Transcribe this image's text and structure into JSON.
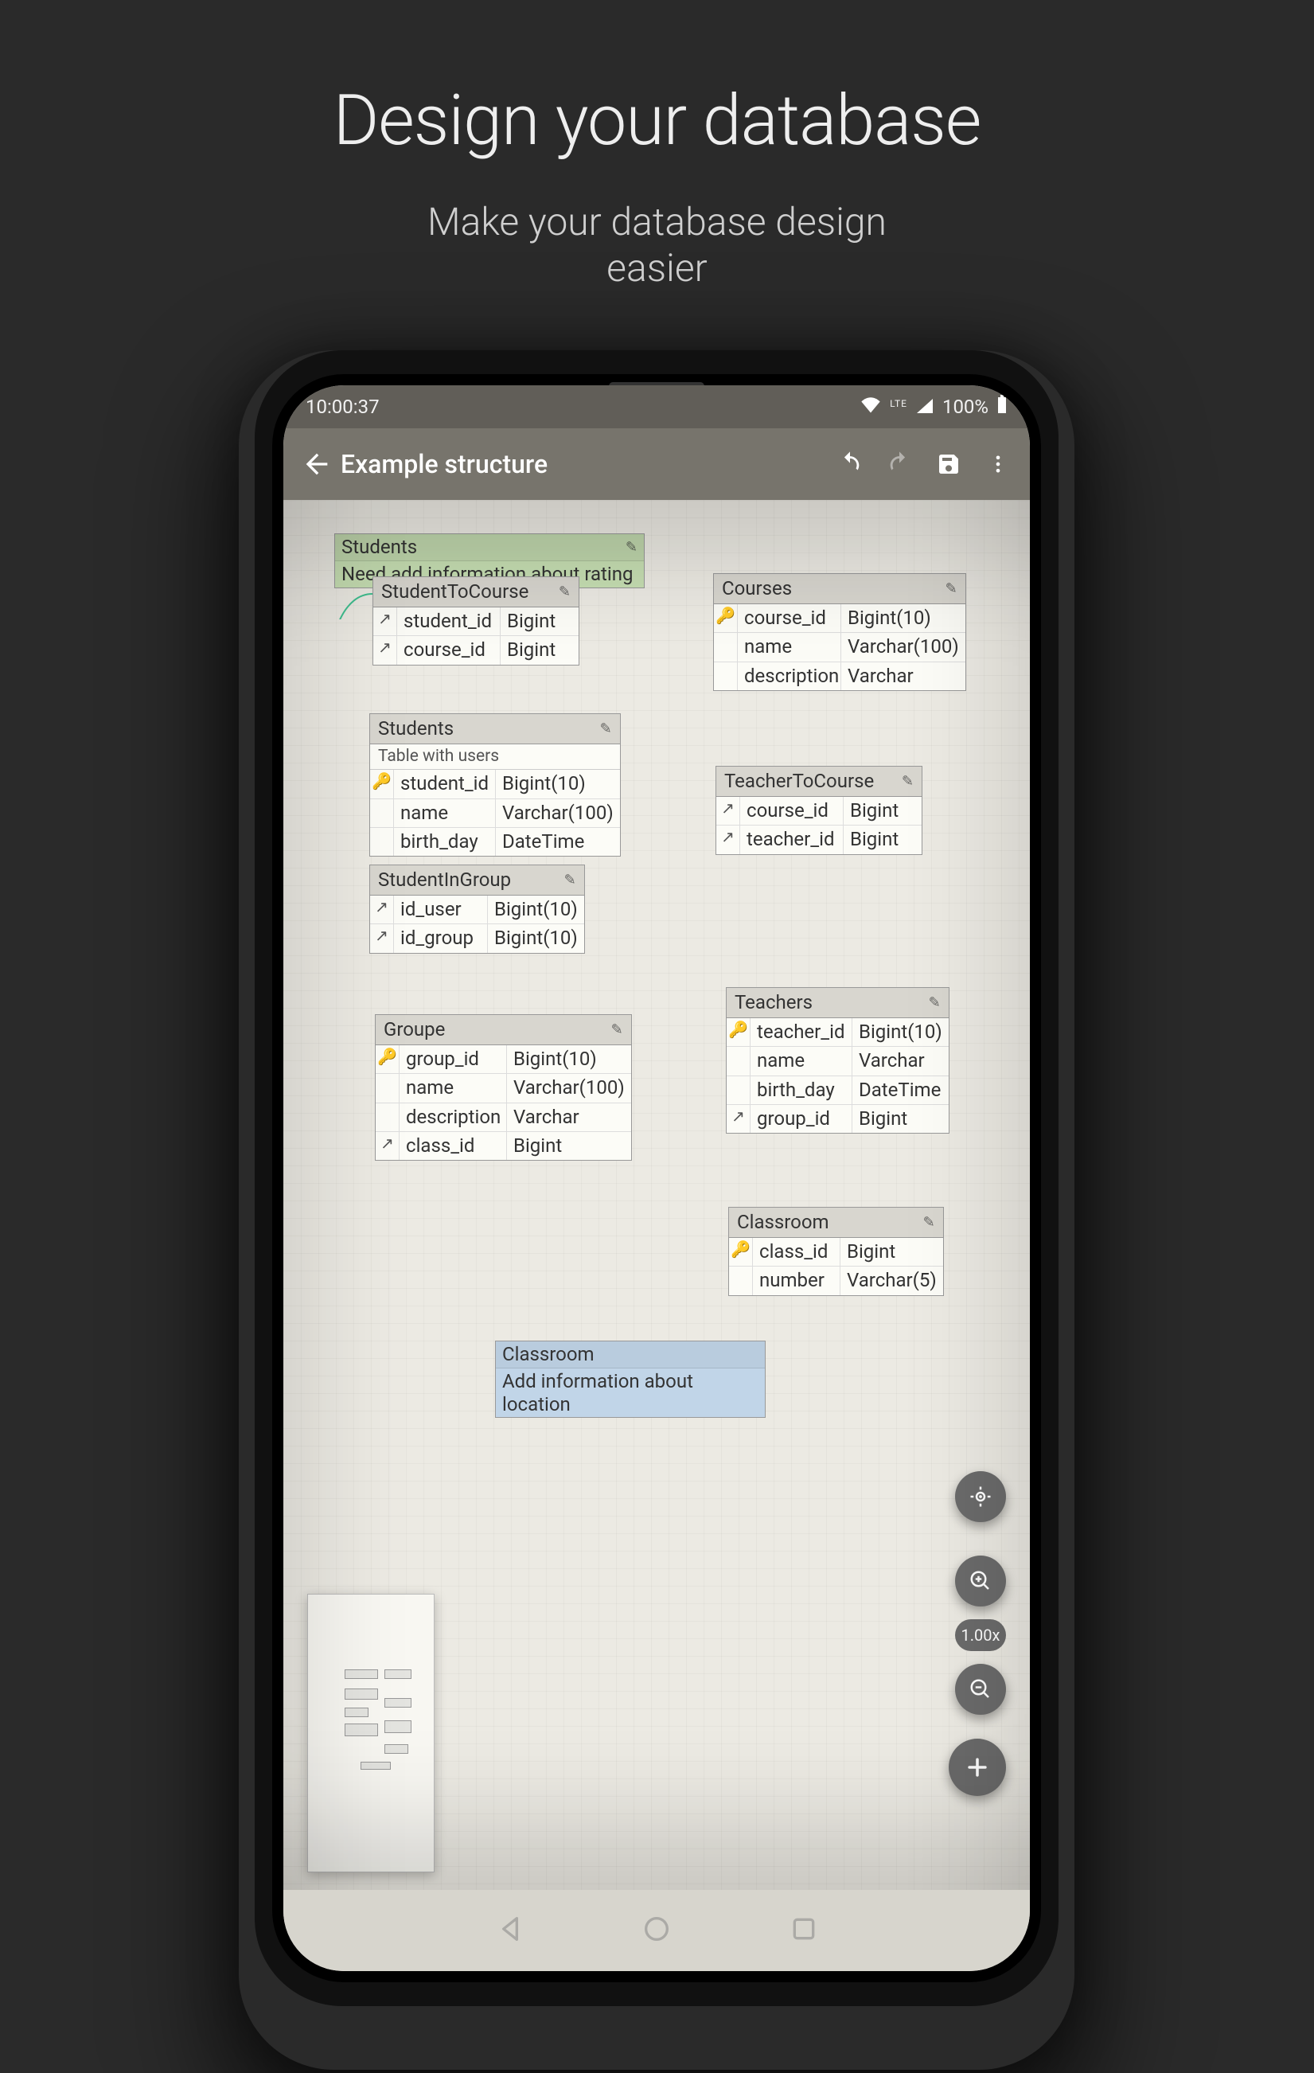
{
  "promo": {
    "title": "Design your database",
    "subtitle1": "Make your database design",
    "subtitle2": "easier"
  },
  "statusbar": {
    "time": "10:00:37",
    "lte": "LTE",
    "battery": "100%"
  },
  "appbar": {
    "title": "Example structure"
  },
  "zoom_label": "1.00x",
  "notes": {
    "students": {
      "title": "Students",
      "body": "Need add information about rating"
    },
    "classroom": {
      "title": "Classroom",
      "body": "Add information about location"
    }
  },
  "tables": {
    "studentToCourse": {
      "title": "StudentToCourse",
      "rows": [
        {
          "icon": "↗",
          "name": "student_id",
          "type": "Bigint"
        },
        {
          "icon": "↗",
          "name": "course_id",
          "type": "Bigint"
        }
      ]
    },
    "courses": {
      "title": "Courses",
      "rows": [
        {
          "icon": "🔑",
          "name": "course_id",
          "type": "Bigint(10)"
        },
        {
          "icon": "",
          "name": "name",
          "type": "Varchar(100)"
        },
        {
          "icon": "",
          "name": "description",
          "type": "Varchar"
        }
      ]
    },
    "students": {
      "title": "Students",
      "subtitle": "Table with users",
      "rows": [
        {
          "icon": "🔑",
          "name": "student_id",
          "type": "Bigint(10)"
        },
        {
          "icon": "",
          "name": "name",
          "type": "Varchar(100)"
        },
        {
          "icon": "",
          "name": "birth_day",
          "type": "DateTime"
        }
      ]
    },
    "teacherToCourse": {
      "title": "TeacherToCourse",
      "rows": [
        {
          "icon": "↗",
          "name": "course_id",
          "type": "Bigint"
        },
        {
          "icon": "↗",
          "name": "teacher_id",
          "type": "Bigint"
        }
      ]
    },
    "studentInGroup": {
      "title": "StudentInGroup",
      "rows": [
        {
          "icon": "↗",
          "name": "id_user",
          "type": "Bigint(10)"
        },
        {
          "icon": "↗",
          "name": "id_group",
          "type": "Bigint(10)"
        }
      ]
    },
    "groupe": {
      "title": "Groupe",
      "rows": [
        {
          "icon": "🔑",
          "name": "group_id",
          "type": "Bigint(10)"
        },
        {
          "icon": "",
          "name": "name",
          "type": "Varchar(100)"
        },
        {
          "icon": "",
          "name": "description",
          "type": "Varchar"
        },
        {
          "icon": "↗",
          "name": "class_id",
          "type": "Bigint"
        }
      ]
    },
    "teachers": {
      "title": "Teachers",
      "rows": [
        {
          "icon": "🔑",
          "name": "teacher_id",
          "type": "Bigint(10)"
        },
        {
          "icon": "",
          "name": "name",
          "type": "Varchar"
        },
        {
          "icon": "",
          "name": "birth_day",
          "type": "DateTime"
        },
        {
          "icon": "↗",
          "name": "group_id",
          "type": "Bigint"
        }
      ]
    },
    "classroom": {
      "title": "Classroom",
      "rows": [
        {
          "icon": "🔑",
          "name": "class_id",
          "type": "Bigint"
        },
        {
          "icon": "",
          "name": "number",
          "type": "Varchar(5)"
        }
      ]
    }
  }
}
